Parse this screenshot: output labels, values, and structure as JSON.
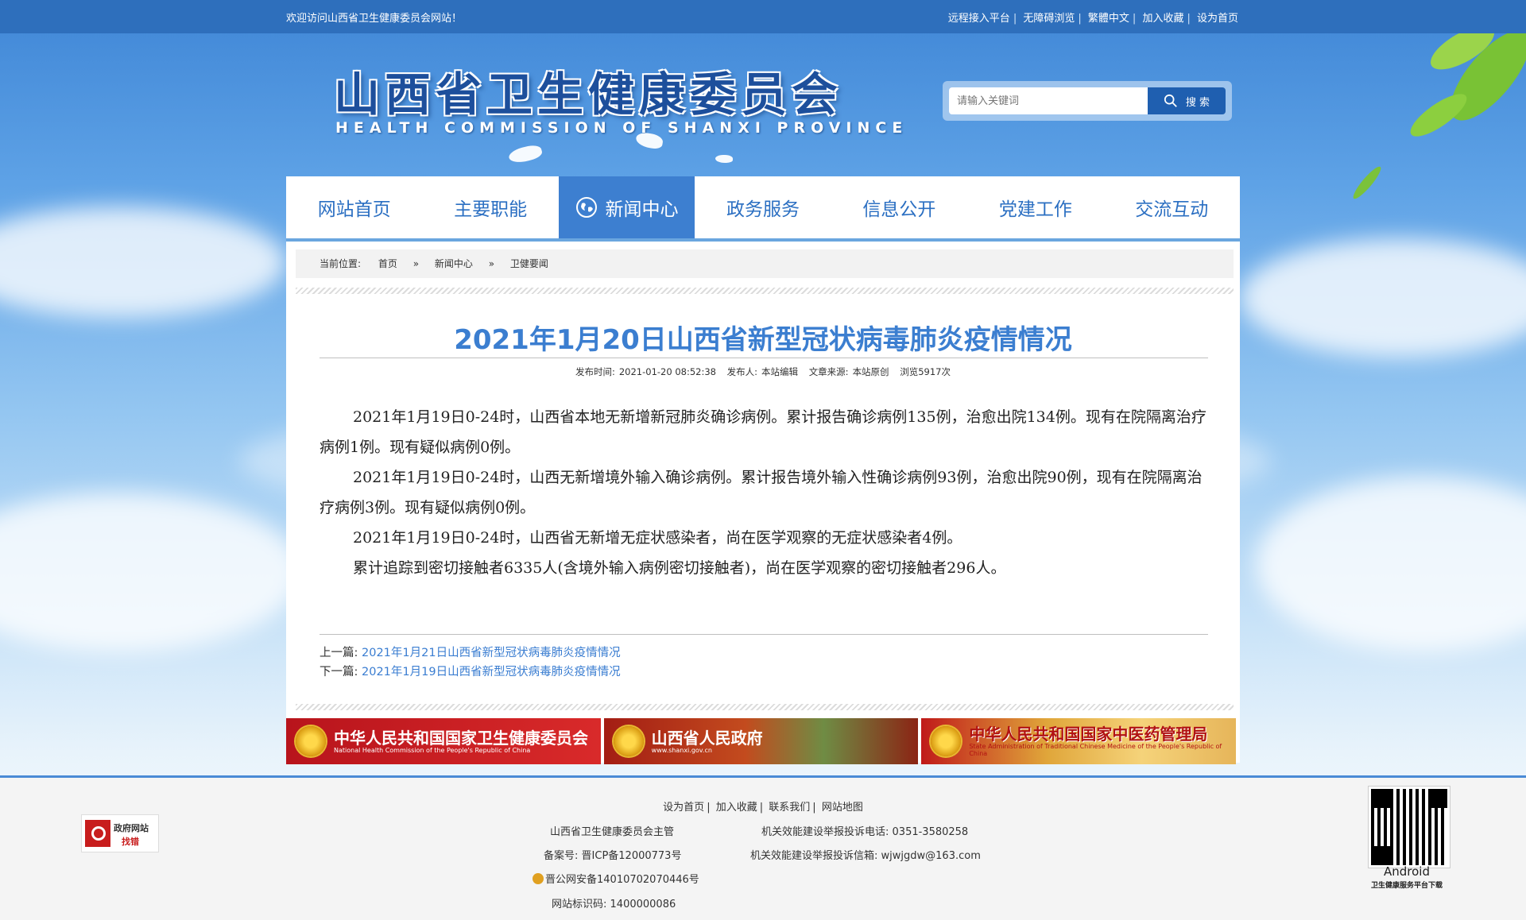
{
  "topbar": {
    "welcome": "欢迎访问山西省卫生健康委员会网站！",
    "links": [
      "远程接入平台",
      "无障碍浏览",
      "繁體中文",
      "加入收藏",
      "设为首页"
    ]
  },
  "header": {
    "title": "山西省卫生健康委员会",
    "subtitle": "HEALTH COMMISSION OF SHANXI PROVINCE"
  },
  "search": {
    "placeholder": "请输入关键词",
    "button": "搜 索"
  },
  "nav": {
    "items": [
      {
        "label": "网站首页"
      },
      {
        "label": "主要职能"
      },
      {
        "label": "新闻中心",
        "active": true
      },
      {
        "label": "政务服务"
      },
      {
        "label": "信息公开"
      },
      {
        "label": "党建工作"
      },
      {
        "label": "交流互动"
      }
    ]
  },
  "breadcrumb": {
    "label": "当前位置:",
    "items": [
      "首页",
      "新闻中心",
      "卫健要闻"
    ],
    "separator": "»"
  },
  "article": {
    "title": "2021年1月20日山西省新型冠状病毒肺炎疫情情况",
    "meta": {
      "published_label": "发布时间:",
      "published": "2021-01-20 08:52:38",
      "publisher_label": "发布人:",
      "publisher": "本站编辑",
      "source_label": "文章来源:",
      "source": "本站原创",
      "views": "浏览5917次"
    },
    "paragraphs": [
      "2021年1月19日0-24时，山西省本地无新增新冠肺炎确诊病例。累计报告确诊病例135例，治愈出院134例。现有在院隔离治疗病例1例。现有疑似病例0例。",
      "2021年1月19日0-24时，山西无新增境外输入确诊病例。累计报告境外输入性确诊病例93例，治愈出院90例，现有在院隔离治疗病例3例。现有疑似病例0例。",
      "2021年1月19日0-24时，山西省无新增无症状感染者，尚在医学观察的无症状感染者4例。",
      "累计追踪到密切接触者6335人(含境外输入病例密切接触者)，尚在医学观察的密切接触者296人。"
    ],
    "prev_label": "上一篇:",
    "prev_title": "2021年1月21日山西省新型冠状病毒肺炎疫情情况",
    "next_label": "下一篇:",
    "next_title": "2021年1月19日山西省新型冠状病毒肺炎疫情情况"
  },
  "banners": [
    {
      "title": "中华人民共和国国家卫生健康委员会",
      "subtitle": "National Health Commission of the People's Republic of China"
    },
    {
      "title": "山西省人民政府",
      "subtitle": "www.shanxi.gov.cn"
    },
    {
      "title": "中华人民共和国国家中医药管理局",
      "subtitle": "State Administration of Traditional Chinese Medicine of the People's Republic of China"
    }
  ],
  "footer": {
    "links": [
      "设为首页",
      "加入收藏",
      "联系我们",
      "网站地图"
    ],
    "sponsor": "山西省卫生健康委员会主管",
    "complaint_phone_label": "机关效能建设举报投诉电话:",
    "complaint_phone": "0351-3580258",
    "icp_label": "备案号:",
    "icp": "晋ICP备12000773号",
    "complaint_email_label": "机关效能建设举报投诉信箱:",
    "complaint_email": "wjwjgdw@163.com",
    "police_record": "晋公网安备14010702070446号",
    "site_id_label": "网站标识码:",
    "site_id": "1400000086",
    "error_badge_line1": "政府网站",
    "error_badge_line2": "找错",
    "qr_label": "Android",
    "qr_caption": "卫生健康服务平台下载"
  }
}
